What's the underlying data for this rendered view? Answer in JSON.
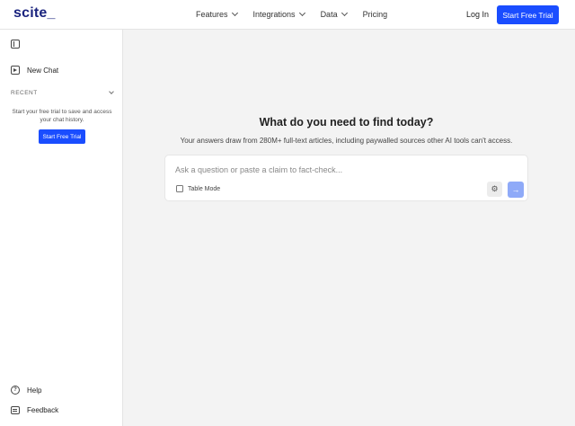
{
  "header": {
    "logo": "scite_",
    "nav": [
      {
        "label": "Features",
        "dropdown": true
      },
      {
        "label": "Integrations",
        "dropdown": true
      },
      {
        "label": "Data",
        "dropdown": true
      },
      {
        "label": "Pricing",
        "dropdown": false
      }
    ],
    "login_label": "Log In",
    "trial_label": "Start Free Trial"
  },
  "sidebar": {
    "collapse_icon": "sidebar-collapse-icon",
    "new_chat_label": "New Chat",
    "recent_label": "RECENT",
    "trial_message": "Start your free trial to save and access your chat history.",
    "trial_button": "Start Free Trial",
    "help_label": "Help",
    "feedback_label": "Feedback"
  },
  "main": {
    "headline": "What do you need to find today?",
    "subline": "Your answers draw from 280M+ full-text articles, including paywalled sources other AI tools can't access.",
    "search": {
      "placeholder": "Ask a question or paste a claim to fact-check...",
      "value": ""
    },
    "table_mode_label": "Table Mode",
    "table_mode_checked": false,
    "settings_icon": "gear-icon",
    "send_icon": "arrow-right-icon"
  },
  "colors": {
    "accent": "#1a4dff",
    "send_disabled": "#8faaf8",
    "logo": "#1a237e",
    "background": "#f3f3f3"
  }
}
